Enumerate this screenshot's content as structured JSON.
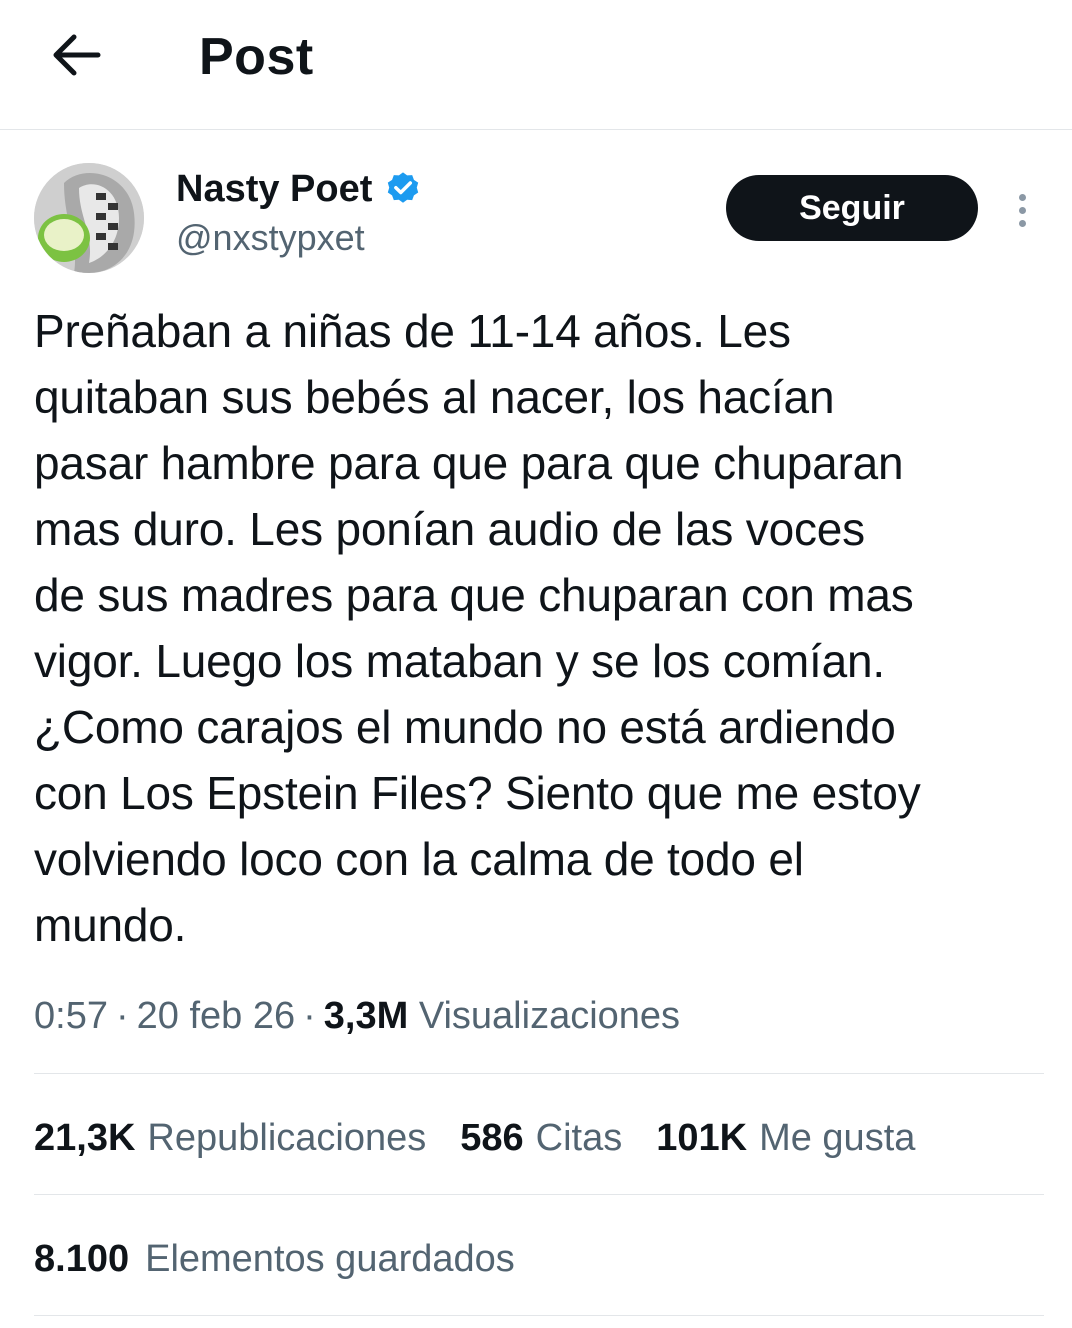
{
  "header": {
    "title": "Post",
    "back_icon": "arrow-left-icon"
  },
  "author": {
    "name": "Nasty Poet",
    "handle": "@nxstypxet",
    "verified": true,
    "verified_color": "#1d9bf0"
  },
  "actions": {
    "follow_label": "Seguir",
    "more_icon": "more-vertical-icon"
  },
  "post": {
    "text": "Preñaban a niñas de 11-14 años. Les\nquitaban sus bebés al nacer, los hacían\npasar hambre para que para que chuparan\nmas duro. Les ponían audio de las voces\nde sus madres para que chuparan con mas\nvigor. Luego los mataban y se los comían.\n¿Como carajos el mundo no está ardiendo\ncon Los Epstein Files? Siento que me estoy\nvolviendo loco con la calma de todo el\nmundo."
  },
  "meta": {
    "time": "0:57",
    "date": "20 feb 26",
    "views_count": "3,3M",
    "views_label": "Visualizaciones",
    "separator": "·"
  },
  "stats": {
    "reposts_count": "21,3K",
    "reposts_label": "Republicaciones",
    "quotes_count": "586",
    "quotes_label": "Citas",
    "likes_count": "101K",
    "likes_label": "Me gusta"
  },
  "saved": {
    "count": "8.100",
    "label": "Elementos guardados"
  },
  "colors": {
    "text_primary": "#0f1419",
    "text_secondary": "#536471",
    "divider": "#e3e6e9",
    "follow_bg": "#0f1419"
  }
}
